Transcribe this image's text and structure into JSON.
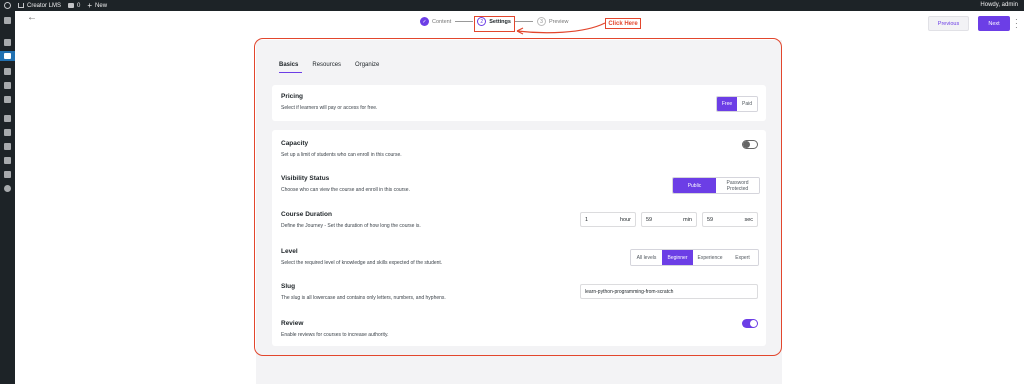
{
  "adminbar": {
    "site_name": "Creator LMS",
    "comments_count": "0",
    "new_label": "New",
    "howdy": "Howdy, admin"
  },
  "stepper": {
    "steps": [
      {
        "num": "",
        "label": "Content",
        "state": "done"
      },
      {
        "num": "2",
        "label": "Settings",
        "state": "current"
      },
      {
        "num": "3",
        "label": "Preview",
        "state": "upcoming"
      }
    ],
    "callout": "Click Here"
  },
  "actions": {
    "previous": "Previous",
    "next": "Next"
  },
  "tabs": [
    "Basics",
    "Resources",
    "Organize"
  ],
  "pricing": {
    "title": "Pricing",
    "desc": "Select if learners will pay or access for free.",
    "options": [
      "Free",
      "Paid"
    ],
    "selected": "Free"
  },
  "capacity": {
    "title": "Capacity",
    "desc": "Set up a limit of students who can enroll in this course.",
    "enabled": false
  },
  "visibility": {
    "title": "Visibility Status",
    "desc": "Choose who can view the course and enroll in this course.",
    "options": [
      "Public",
      "Password Protected"
    ],
    "selected": "Public"
  },
  "duration": {
    "title": "Course Duration",
    "desc": "Define the Journey - Set the duration of how long the course is.",
    "fields": [
      {
        "value": "1",
        "unit": "hour"
      },
      {
        "value": "59",
        "unit": "min"
      },
      {
        "value": "59",
        "unit": "sec"
      }
    ]
  },
  "level": {
    "title": "Level",
    "desc": "Select the required level of knowledge and skills expected of the student.",
    "options": [
      "All levels",
      "Beginner",
      "Experience",
      "Expert"
    ],
    "selected": "Beginner"
  },
  "slug": {
    "title": "Slug",
    "desc": "The slug is all lowercase and contains only letters, numbers, and hyphens.",
    "value": "learn-python-programming-from-scratch"
  },
  "review": {
    "title": "Review",
    "desc": "Enable reviews for courses to increase authority.",
    "enabled": true
  },
  "colors": {
    "accent": "#6c3ee6",
    "annotation": "#e2462d",
    "admin_bar": "#1d2327",
    "wp_blue": "#2271b1"
  }
}
